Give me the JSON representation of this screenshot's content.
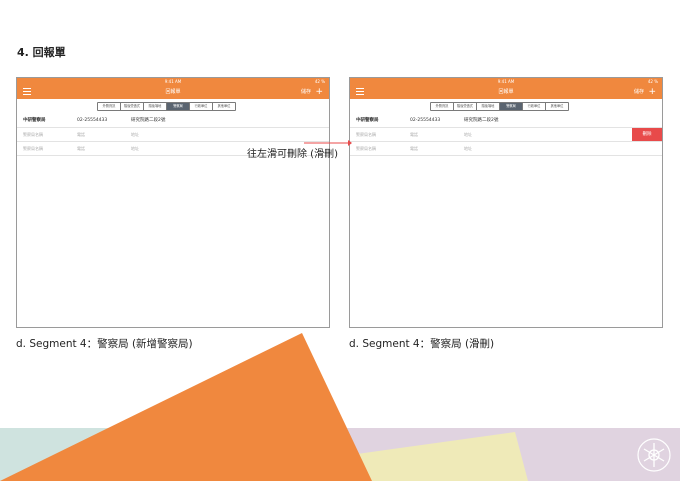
{
  "slide": {
    "title": "4. 回報單"
  },
  "screens": [
    {
      "status": {
        "time": "9:41 AM",
        "battery": "42 %"
      },
      "nav": {
        "title": "回報單",
        "action": "儲存"
      },
      "segments": [
        {
          "label": "外覽資訊",
          "active": false
        },
        {
          "label": "隨後營造式",
          "active": false
        },
        {
          "label": "隨後場地",
          "active": false
        },
        {
          "label": "警察局",
          "active": true
        },
        {
          "label": "行政單位",
          "active": false
        },
        {
          "label": "其他單位",
          "active": false
        }
      ],
      "rows": [
        {
          "name": "中研警察局",
          "phone": "02-25554433",
          "address": "研究院路二段2號",
          "filled": true
        },
        {
          "name": "警察局名稱",
          "phone": "電話",
          "address": "地址",
          "filled": false
        },
        {
          "name": "警察局名稱",
          "phone": "電話",
          "address": "地址",
          "filled": false
        }
      ],
      "caption": "d. Segment 4：警察局 (新增警察局)"
    },
    {
      "status": {
        "time": "9:41 AM",
        "battery": "42 %"
      },
      "nav": {
        "title": "回報單",
        "action": "儲存"
      },
      "segments": [
        {
          "label": "外覽資訊",
          "active": false
        },
        {
          "label": "隨後營造式",
          "active": false
        },
        {
          "label": "隨後場地",
          "active": false
        },
        {
          "label": "警察局",
          "active": true
        },
        {
          "label": "行政單位",
          "active": false
        },
        {
          "label": "其他單位",
          "active": false
        }
      ],
      "rows": [
        {
          "name": "中研警察局",
          "phone": "02-25554433",
          "address": "研究院路二段2號",
          "filled": true
        },
        {
          "name": "警察局名稱",
          "phone": "電話",
          "address": "地址",
          "filled": false
        },
        {
          "name": "警察局名稱",
          "phone": "電話",
          "address": "地址",
          "filled": false
        }
      ],
      "delete_label": "刪除",
      "caption": "d. Segment 4：警察局 (滑刪)"
    }
  ],
  "annotation": "往左滑可刪除 (滑刪)",
  "colors": {
    "accent": "#f0883e",
    "segment_active": "#5a6470",
    "delete": "#e84a4a",
    "bg_teal": "#cfe3df",
    "bg_lavender": "#e0d3e0",
    "bg_yellow": "#efeab8"
  }
}
